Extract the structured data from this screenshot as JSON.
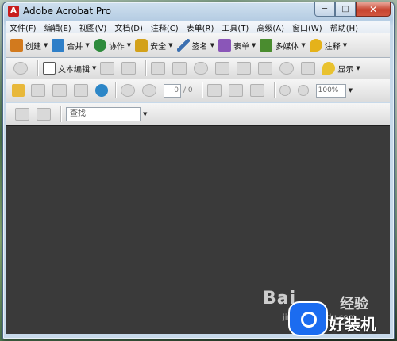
{
  "window": {
    "title": "Adobe Acrobat Pro",
    "app_icon_glyph": "A",
    "controls": {
      "minimize": "─",
      "maximize": "□",
      "close": "✕"
    }
  },
  "menubar": {
    "items": [
      "文件(F)",
      "编辑(E)",
      "视图(V)",
      "文档(D)",
      "注释(C)",
      "表单(R)",
      "工具(T)",
      "高级(A)",
      "窗口(W)",
      "帮助(H)"
    ]
  },
  "toolbar1": {
    "items": [
      {
        "label": "创建",
        "icon": "create-pdf-icon",
        "color": "#d27a1e"
      },
      {
        "label": "合并",
        "icon": "combine-files-icon",
        "color": "#2f7fc8"
      },
      {
        "label": "协作",
        "icon": "collaborate-icon",
        "color": "#2e8b3c"
      },
      {
        "label": "安全",
        "icon": "lock-icon",
        "color": "#d3a11a"
      },
      {
        "label": "签名",
        "icon": "pen-sign-icon",
        "color": "#3b6fb0"
      },
      {
        "label": "表单",
        "icon": "form-icon",
        "color": "#8a56b8"
      },
      {
        "label": "多媒体",
        "icon": "multimedia-icon",
        "color": "#4a8c2f"
      },
      {
        "label": "注释",
        "icon": "comment-icon",
        "color": "#e5b21a"
      }
    ]
  },
  "toolbar2": {
    "text_edit_label": "文本编辑",
    "show_label": "显示"
  },
  "toolbar3": {
    "page_number": "0",
    "page_total": "/ 0",
    "zoom": "100%"
  },
  "toolbar4": {
    "search_label": "查找"
  },
  "watermark": {
    "baidu": "Bai",
    "jingyan": "经验",
    "url": "jingyan.baidu.com",
    "brand": "好装机"
  }
}
